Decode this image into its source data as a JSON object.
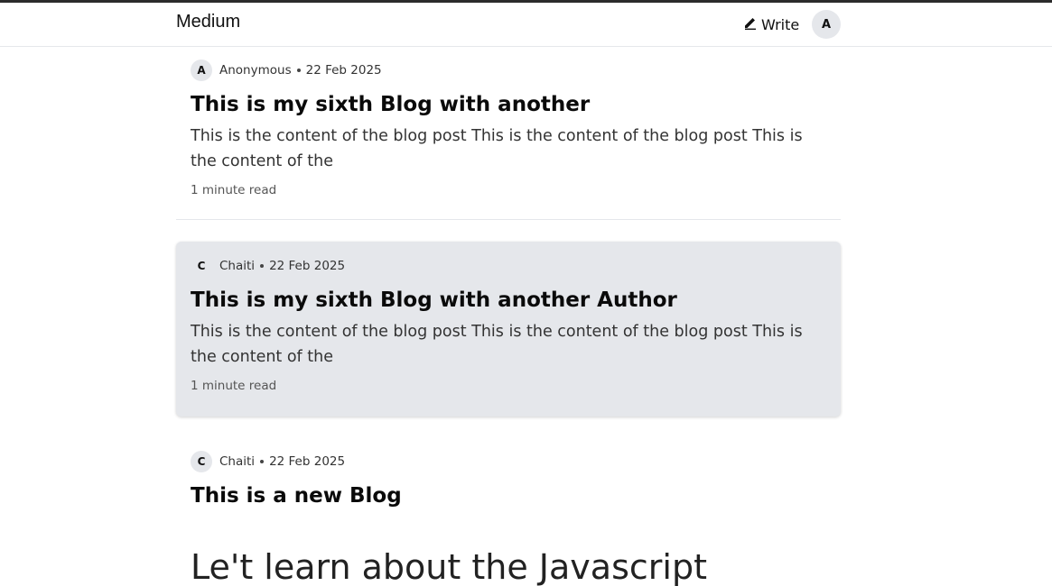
{
  "nav": {
    "brand": "Medium",
    "write_label": "Write",
    "user_initial": "A"
  },
  "posts": [
    {
      "initial": "A",
      "author": "Anonymous",
      "date": "22 Feb 2025",
      "title": "This is my sixth Blog with another",
      "excerpt": "This is the content of the blog post This is the content of the blog post This is the content of the",
      "read_time": "1 minute read"
    },
    {
      "initial": "C",
      "author": "Chaiti",
      "date": "22 Feb 2025",
      "title": "This is my sixth Blog with another Author",
      "excerpt": "This is the content of the blog post This is the content of the blog post This is the content of the",
      "read_time": "1 minute read"
    },
    {
      "initial": "C",
      "author": "Chaiti",
      "date": "22 Feb 2025",
      "title": "This is a new Blog",
      "content_heading": "Le't learn about the Javascript"
    }
  ]
}
